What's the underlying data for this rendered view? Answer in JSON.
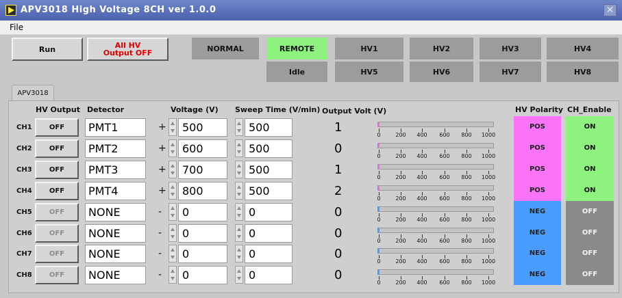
{
  "window": {
    "title": "APV3018 High Voltage 8CH   ver 1.0.0"
  },
  "menu": {
    "file": "File"
  },
  "toolbar": {
    "run": "Run",
    "all_hv_off_line1": "All HV",
    "all_hv_off_line2": "Output OFF",
    "mode": "NORMAL",
    "control": "REMOTE",
    "status": "Idle",
    "hv_buttons": [
      "HV1",
      "HV2",
      "HV3",
      "HV4",
      "HV5",
      "HV6",
      "HV7",
      "HV8"
    ]
  },
  "tab": {
    "label": "APV3018"
  },
  "headers": {
    "hv_output": "HV Output",
    "detector": "Detector",
    "voltage": "Voltage (V)",
    "sweep": "Sweep Time (V/min)",
    "output_volt": "Output Volt (V)",
    "polarity": "HV Polarity",
    "enable": "CH_Enable"
  },
  "gauge_ticks": [
    "0",
    "200",
    "400",
    "600",
    "800",
    "1000"
  ],
  "channels": [
    {
      "ch": "CH1",
      "hv_output": "OFF",
      "detector": "PMT1",
      "sign": "+",
      "voltage": "500",
      "sweep": "500",
      "output": "1",
      "level": 0.001,
      "polarity": "POS",
      "enable": "ON"
    },
    {
      "ch": "CH2",
      "hv_output": "OFF",
      "detector": "PMT2",
      "sign": "+",
      "voltage": "600",
      "sweep": "500",
      "output": "0",
      "level": 0.0,
      "polarity": "POS",
      "enable": "ON"
    },
    {
      "ch": "CH3",
      "hv_output": "OFF",
      "detector": "PMT3",
      "sign": "+",
      "voltage": "700",
      "sweep": "500",
      "output": "1",
      "level": 0.001,
      "polarity": "POS",
      "enable": "ON"
    },
    {
      "ch": "CH4",
      "hv_output": "OFF",
      "detector": "PMT4",
      "sign": "+",
      "voltage": "800",
      "sweep": "500",
      "output": "2",
      "level": 0.002,
      "polarity": "POS",
      "enable": "ON"
    },
    {
      "ch": "CH5",
      "hv_output": "OFF",
      "detector": "NONE",
      "sign": "-",
      "voltage": "0",
      "sweep": "0",
      "output": "0",
      "level": 0.0,
      "polarity": "NEG",
      "enable": "OFF"
    },
    {
      "ch": "CH6",
      "hv_output": "OFF",
      "detector": "NONE",
      "sign": "-",
      "voltage": "0",
      "sweep": "0",
      "output": "0",
      "level": 0.0,
      "polarity": "NEG",
      "enable": "OFF"
    },
    {
      "ch": "CH7",
      "hv_output": "OFF",
      "detector": "NONE",
      "sign": "-",
      "voltage": "0",
      "sweep": "0",
      "output": "0",
      "level": 0.0,
      "polarity": "NEG",
      "enable": "OFF"
    },
    {
      "ch": "CH8",
      "hv_output": "OFF",
      "detector": "NONE",
      "sign": "-",
      "voltage": "0",
      "sweep": "0",
      "output": "0",
      "level": 0.0,
      "polarity": "NEG",
      "enable": "OFF"
    }
  ],
  "colors": {
    "pos": "#fb74f8",
    "neg": "#4a9dff",
    "on": "#8ef27f",
    "off_bg": "#8a8a8a",
    "pos_gauge_fill": "#e070e0",
    "neg_gauge_fill": "#4a9dff"
  }
}
